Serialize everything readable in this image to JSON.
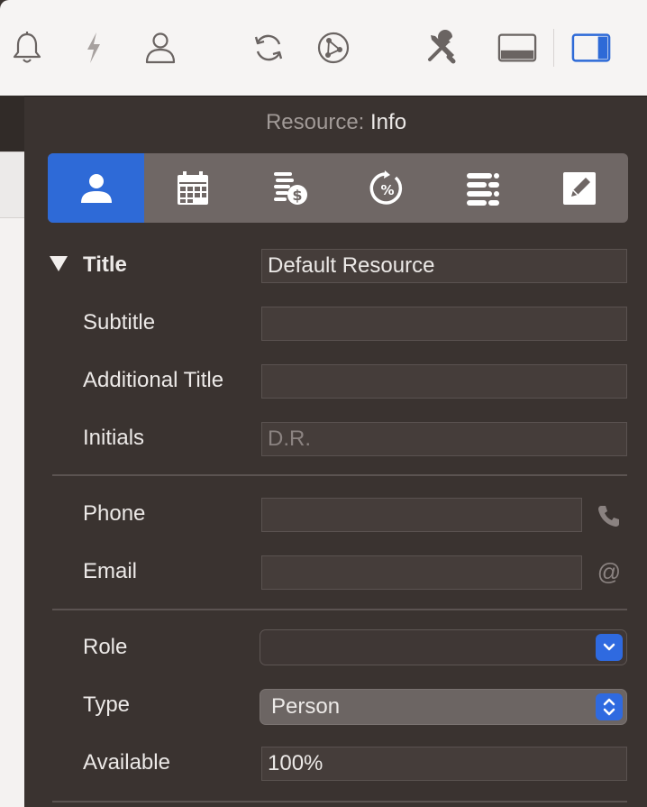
{
  "inspector": {
    "title_prefix": "Resource:",
    "title_main": "Info"
  },
  "toolbar": {
    "icons": [
      "bell-icon",
      "bolt-icon",
      "person-icon",
      "sync-icon",
      "network-icon",
      "tools-icon",
      "bottom-panel-icon",
      "right-sidebar-icon"
    ],
    "active": "right-sidebar-icon"
  },
  "segments": [
    "person-icon",
    "calendar-icon",
    "cost-icon",
    "percent-icon",
    "list-icon",
    "edit-icon"
  ],
  "fields": {
    "title": {
      "label": "Title",
      "value": "Default Resource"
    },
    "subtitle": {
      "label": "Subtitle",
      "value": ""
    },
    "additional_title": {
      "label": "Additional Title",
      "value": ""
    },
    "initials": {
      "label": "Initials",
      "placeholder": "D.R."
    },
    "phone": {
      "label": "Phone",
      "value": ""
    },
    "email": {
      "label": "Email",
      "value": "",
      "icon_text": "@"
    },
    "role": {
      "label": "Role",
      "value": ""
    },
    "type": {
      "label": "Type",
      "value": "Person"
    },
    "available": {
      "label": "Available",
      "value": "100%"
    }
  },
  "colors": {
    "accent": "#2e6ad7",
    "panel_bg": "#3a3330",
    "toolbar_bg": "#f6f4f3"
  }
}
